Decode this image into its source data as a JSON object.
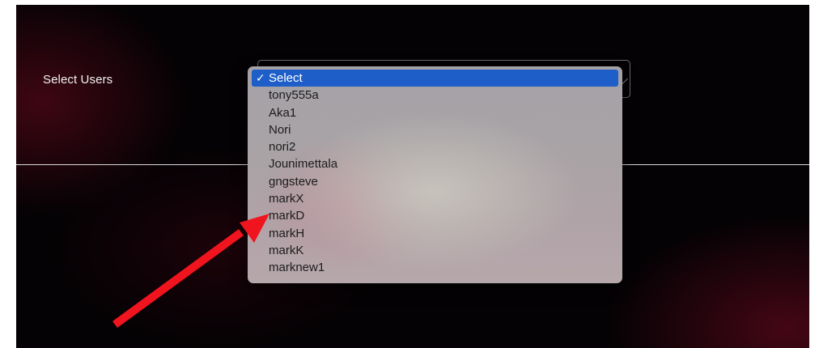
{
  "form": {
    "label": "Select Users"
  },
  "select": {
    "selected": "Select",
    "check_glyph": "✓",
    "options": [
      "Select",
      "tony555a",
      "Aka1",
      "Nori",
      "nori2",
      "Jounimettala",
      "gngsteve",
      "markX",
      "markD",
      "markH",
      "markK",
      "marknew1"
    ]
  },
  "annotation": {
    "arrow_color": "#f0141e",
    "points_to": "markD"
  },
  "colors": {
    "selection_highlight": "#1d5ec9",
    "background": "#040204",
    "accent_gradient": "#7a0c22"
  }
}
